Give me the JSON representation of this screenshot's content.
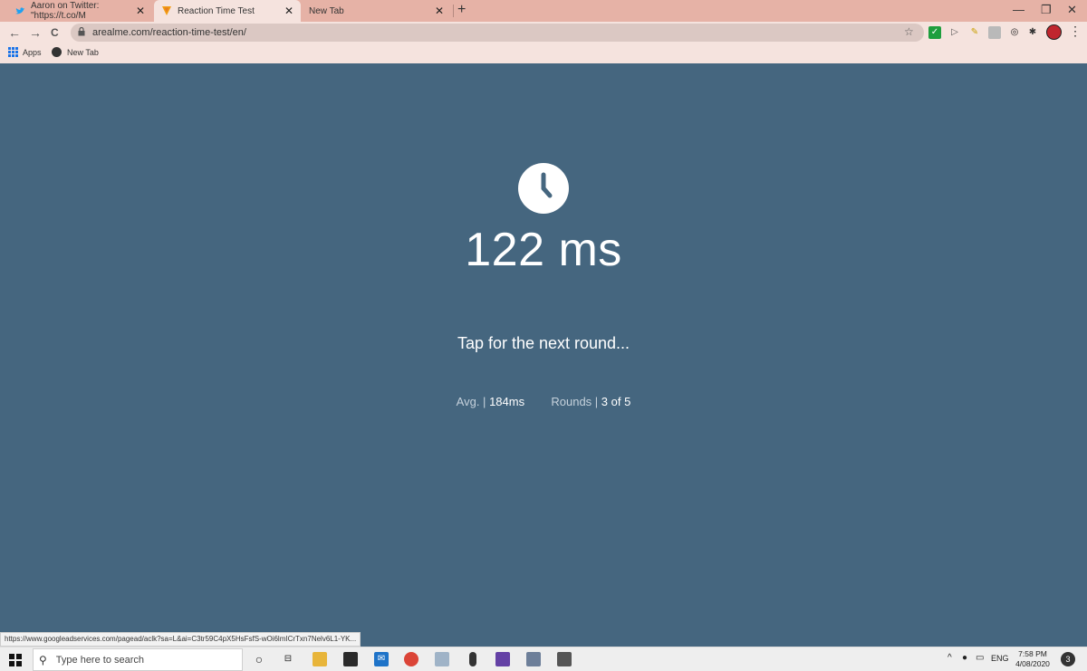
{
  "browser": {
    "tabs": [
      {
        "title": "Aaron on Twitter: \"https://t.co/M",
        "close": "✕"
      },
      {
        "title": "Reaction Time Test",
        "close": "✕"
      },
      {
        "title": "New Tab",
        "close": "✕"
      }
    ],
    "new_tab_symbol": "+",
    "window_controls": {
      "minimize": "—",
      "restore": "❐",
      "close": "✕"
    },
    "nav": {
      "back": "←",
      "forward": "→",
      "reload": "C"
    },
    "url": "arealme.com/reaction-time-test/en/",
    "bookmark_star": "☆",
    "menu": "⋮",
    "bookmarks": [
      {
        "label": "Apps"
      },
      {
        "label": "New Tab"
      }
    ]
  },
  "page": {
    "icon": "clock-icon",
    "result": "122 ms",
    "prompt": "Tap for the next round...",
    "avg_label": "Avg. |",
    "avg_value": "184ms",
    "rounds_label": "Rounds |",
    "rounds_value": "3 of 5",
    "status_url": "https://www.googleadservices.com/pagead/aclk?sa=L&ai=C3tr59C4pX5HsFsfS-wOi6lmICrTxn7Nelv6L1-YK..."
  },
  "taskbar": {
    "search_placeholder": "Type here to search",
    "tray": {
      "caret": "^",
      "lang": "ENG"
    },
    "time": "7:58 PM",
    "date": "4/08/2020",
    "notifications": "3"
  },
  "colors": {
    "page_bg": "#45667f",
    "tab_strip": "#e6b2a6",
    "toolbar": "#f5e3de"
  }
}
